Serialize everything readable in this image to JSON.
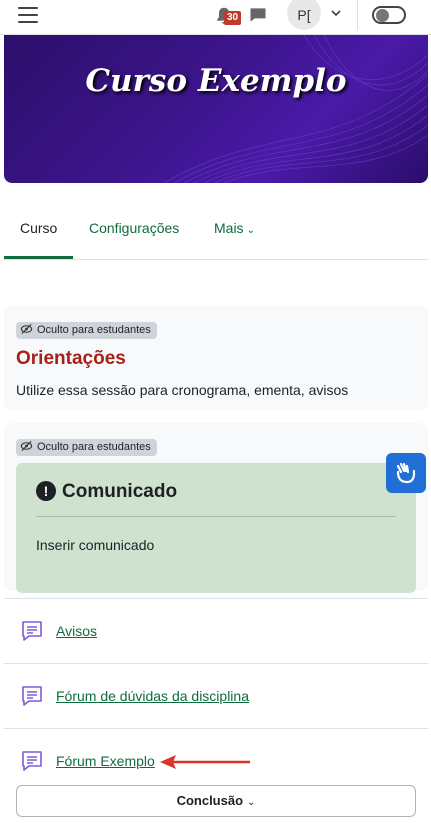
{
  "header": {
    "notification_count": "30",
    "user_initials": "P[",
    "icons": [
      "menu-icon",
      "bell-icon",
      "chat-icon",
      "chevron-down-icon",
      "toggle-switch"
    ]
  },
  "banner": {
    "title": "Curso Exemplo"
  },
  "tabs": [
    {
      "label": "Curso",
      "active": true
    },
    {
      "label": "Configurações",
      "active": false
    },
    {
      "label": "Mais",
      "active": false
    }
  ],
  "sections": [
    {
      "badge": "Oculto para estudantes",
      "title": "Orientações",
      "description": "Utilize essa sessão para cronograma, ementa, avisos"
    },
    {
      "badge": "Oculto para estudantes",
      "alert_title": "Comunicado",
      "alert_text": "Inserir comunicado"
    }
  ],
  "activities": [
    {
      "label": "Avisos",
      "icon": "forum-icon"
    },
    {
      "label": "Fórum de dúvidas da disciplina",
      "icon": "forum-icon"
    },
    {
      "label": "Fórum Exemplo",
      "icon": "forum-icon"
    }
  ],
  "footer": {
    "completion_label": "Conclusão"
  },
  "colors": {
    "link": "#0f6c3c",
    "section_title": "#a8201a",
    "alert_bg": "#cfe2cf",
    "accessibility": "#1f6fd6",
    "badge": "#c0392b",
    "arrow": "#d9352b"
  }
}
